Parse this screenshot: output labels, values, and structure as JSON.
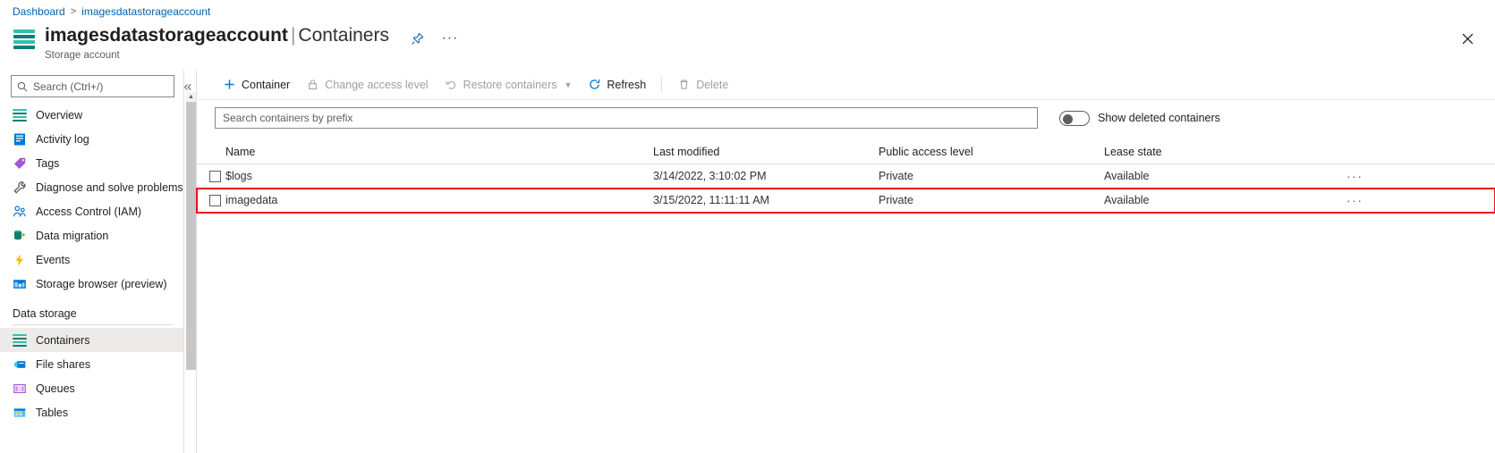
{
  "breadcrumb": {
    "items": [
      {
        "label": "Dashboard"
      },
      {
        "label": "imagesdatastorageaccount"
      }
    ],
    "separator": ">"
  },
  "header": {
    "resource_name": "imagesdatastorageaccount",
    "separator": "|",
    "page_name": "Containers",
    "resource_type": "Storage account",
    "pin_icon": "pin-icon",
    "more_icon": "more-ellipsis-icon",
    "close_icon": "close-x-icon",
    "resource_icon": "storage-account-icon"
  },
  "sidebar": {
    "search": {
      "placeholder": "Search (Ctrl+/)",
      "value": "",
      "icon": "search-icon"
    },
    "collapse_icon": "double-chevron-left-icon",
    "items": [
      {
        "label": "Overview",
        "icon": "overview-icon",
        "active": false
      },
      {
        "label": "Activity log",
        "icon": "activity-log-icon",
        "active": false
      },
      {
        "label": "Tags",
        "icon": "tags-icon",
        "active": false
      },
      {
        "label": "Diagnose and solve problems",
        "icon": "wrench-icon",
        "active": false
      },
      {
        "label": "Access Control (IAM)",
        "icon": "access-control-icon",
        "active": false
      },
      {
        "label": "Data migration",
        "icon": "data-migration-icon",
        "active": false
      },
      {
        "label": "Events",
        "icon": "events-lightning-icon",
        "active": false
      },
      {
        "label": "Storage browser (preview)",
        "icon": "storage-browser-icon",
        "active": false
      }
    ],
    "group_label": "Data storage",
    "group_items": [
      {
        "label": "Containers",
        "icon": "containers-icon",
        "active": true
      },
      {
        "label": "File shares",
        "icon": "file-shares-icon",
        "active": false
      },
      {
        "label": "Queues",
        "icon": "queues-icon",
        "active": false
      },
      {
        "label": "Tables",
        "icon": "tables-icon",
        "active": false
      }
    ]
  },
  "toolbar": {
    "buttons": [
      {
        "label": "Container",
        "icon": "plus-icon",
        "disabled": false,
        "chevron": false
      },
      {
        "label": "Change access level",
        "icon": "lock-icon",
        "disabled": true,
        "chevron": false
      },
      {
        "label": "Restore containers",
        "icon": "undo-icon",
        "disabled": true,
        "chevron": true
      },
      {
        "label": "Refresh",
        "icon": "refresh-icon",
        "disabled": false,
        "chevron": false
      },
      {
        "label": "Delete",
        "icon": "trash-icon",
        "disabled": true,
        "chevron": false
      }
    ]
  },
  "filter": {
    "search": {
      "placeholder": "Search containers by prefix",
      "value": ""
    },
    "toggle": {
      "label": "Show deleted containers",
      "state": "off"
    }
  },
  "table": {
    "columns": [
      {
        "key": "name",
        "label": "Name"
      },
      {
        "key": "mod",
        "label": "Last modified"
      },
      {
        "key": "pub",
        "label": "Public access level"
      },
      {
        "key": "lease",
        "label": "Lease state"
      }
    ],
    "rows": [
      {
        "name": "$logs",
        "mod": "3/14/2022, 3:10:02 PM",
        "pub": "Private",
        "lease": "Available",
        "checked": false,
        "highlighted": false,
        "menu_icon": "more-ellipsis-icon"
      },
      {
        "name": "imagedata",
        "mod": "3/15/2022, 11:11:11 AM",
        "pub": "Private",
        "lease": "Available",
        "checked": false,
        "highlighted": true,
        "menu_icon": "more-ellipsis-icon"
      }
    ]
  },
  "colors": {
    "link": "#0062ad",
    "accent_teal": "#32bfb0",
    "accent_teal_dark": "#0f7d72",
    "highlight_red": "#e81123",
    "disabled_text": "#a19f9d",
    "border": "#e1dfdd"
  }
}
